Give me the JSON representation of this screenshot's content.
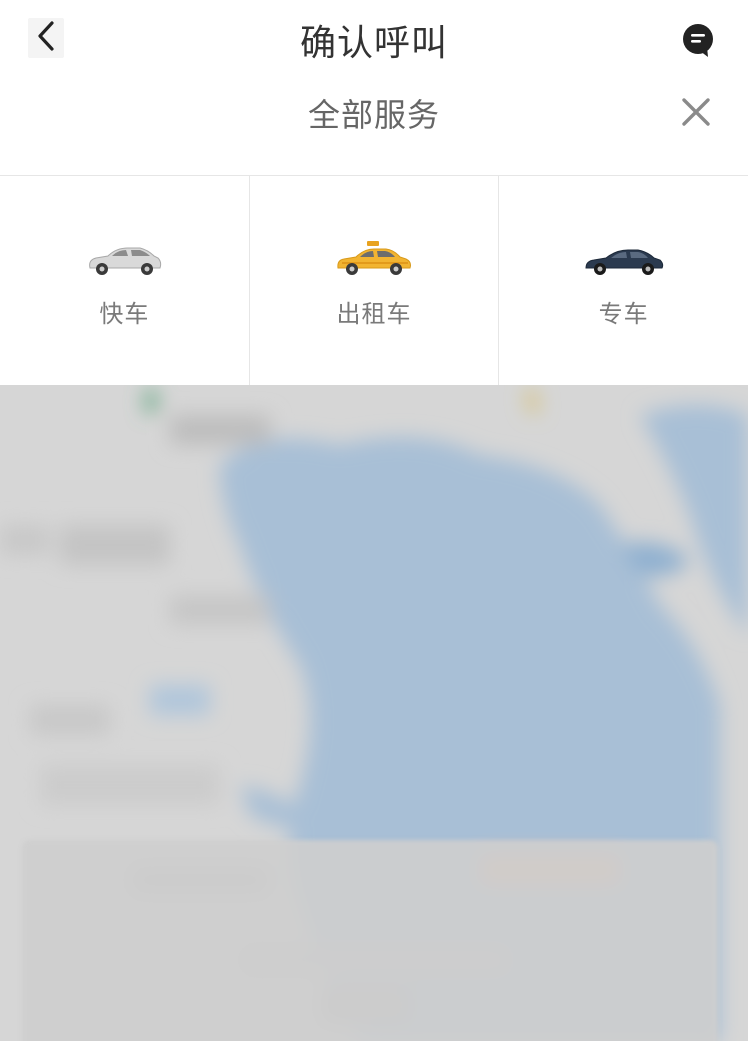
{
  "header": {
    "title": "确认呼叫",
    "back_icon": "chevron-left-icon",
    "message_icon": "message-bubble-icon"
  },
  "sheet": {
    "title": "全部服务",
    "close_icon": "close-icon"
  },
  "services": [
    {
      "label": "快车",
      "icon": "car-silver-icon",
      "color": "#d9d9d9"
    },
    {
      "label": "出租车",
      "icon": "car-taxi-icon",
      "color": "#f2b431"
    },
    {
      "label": "专车",
      "icon": "car-navy-icon",
      "color": "#2b3a4f"
    }
  ],
  "colors": {
    "text_primary": "#333333",
    "text_secondary": "#7a7a7a",
    "divider": "#e6e6e6",
    "map_land": "#d6d6d6",
    "map_water": "#a8bfd6"
  }
}
